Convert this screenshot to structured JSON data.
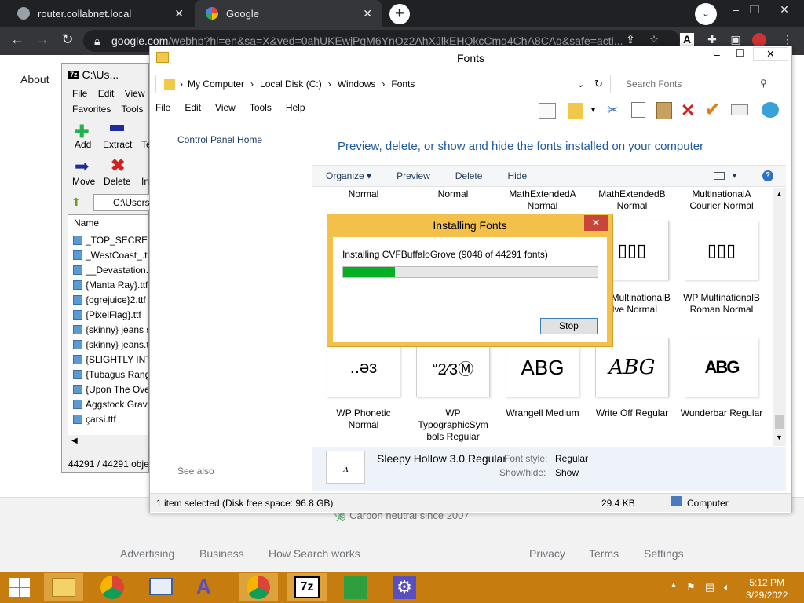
{
  "browser": {
    "tabs": [
      {
        "title": "router.collabnet.local"
      },
      {
        "title": "Google"
      }
    ],
    "url_main": "google.com",
    "url_rest": "/webhp?hl=en&sa=X&ved=0ahUKEwjPgM6YnOz2AhXJlkEHQkcCmg4ChA8CAg&safe=acti..."
  },
  "google": {
    "about": "About",
    "carbon": "Carbon neutral since 2007",
    "footer": [
      "Advertising",
      "Business",
      "How Search works",
      "Privacy",
      "Terms",
      "Settings"
    ]
  },
  "sevenzip": {
    "title": "C:\\Us...",
    "menu1": [
      "File",
      "Edit",
      "View"
    ],
    "menu2": [
      "Favorites",
      "Tools"
    ],
    "tools": [
      "Add",
      "Extract",
      "Te",
      "Move",
      "Delete",
      "In"
    ],
    "path": "C:\\Users\\",
    "col_name": "Name",
    "files": [
      "_TOP_SECRET_...",
      "_WestCoast_.ttf",
      "__Devastation...",
      "{Manta Ray}.ttf",
      "{ogrejuice}2.ttf",
      "{PixelFlag}.ttf",
      "{skinny} jeans s",
      "{skinny} jeans.t",
      "{SLIGHTLY INTO",
      "{Tubagus Rang",
      "{Upon The Ove",
      "Äggstock Gravic",
      "çarsi.ttf"
    ],
    "status": "44291 / 44291 objec"
  },
  "fonts": {
    "title": "Fonts",
    "breadcrumb": [
      "My Computer",
      "Local Disk (C:)",
      "Windows",
      "Fonts"
    ],
    "search_placeholder": "Search Fonts",
    "menu": [
      "File",
      "Edit",
      "View",
      "Tools",
      "Help"
    ],
    "left_link": "Control Panel Home",
    "see_also": "See also",
    "heading": "Preview, delete, or show and hide the fonts installed on your computer",
    "commands": [
      "Organize ▾",
      "Preview",
      "Delete",
      "Hide"
    ],
    "row1": [
      "Normal",
      "Normal",
      "MathExtendedA Normal",
      "MathExtendedB Normal",
      "MultinationalA Courier Normal"
    ],
    "row2_samples": [
      "▯▯▯",
      "▯▯▯"
    ],
    "row2": [
      "WP MultinationalB elve Normal",
      "WP MultinationalB Roman Normal"
    ],
    "row3_samples": [
      "..əɜ",
      "“2⁄3Ⓜ",
      "ABG",
      "ABG",
      "ABG"
    ],
    "row3": [
      "WP Phonetic Normal",
      "WP TypographicSym bols Regular",
      "Wrangell Medium",
      "Write Off Regular",
      "Wunderbar Regular"
    ],
    "detail_name": "Sleepy Hollow 3.0 Regular",
    "detail_style_label": "Font style:",
    "detail_style": "Regular",
    "detail_show_label": "Show/hide:",
    "detail_show": "Show",
    "status_left": "1 item selected (Disk free space: 96.8 GB)",
    "status_size": "29.4 KB",
    "status_loc": "Computer"
  },
  "dialog": {
    "title": "Installing Fonts",
    "message": "Installing CVFBuffaloGrove (9048 of 44291 fonts)",
    "progress_fraction": 0.204,
    "stop": "Stop"
  },
  "taskbar": {
    "time": "5:12 PM",
    "date": "3/29/2022"
  },
  "colors": {
    "chrome_dark": "#202124",
    "taskbar": "#c67c0f",
    "dialog_frame": "#f3c14a",
    "progress": "#06b025",
    "link_blue": "#1e5aa0"
  }
}
